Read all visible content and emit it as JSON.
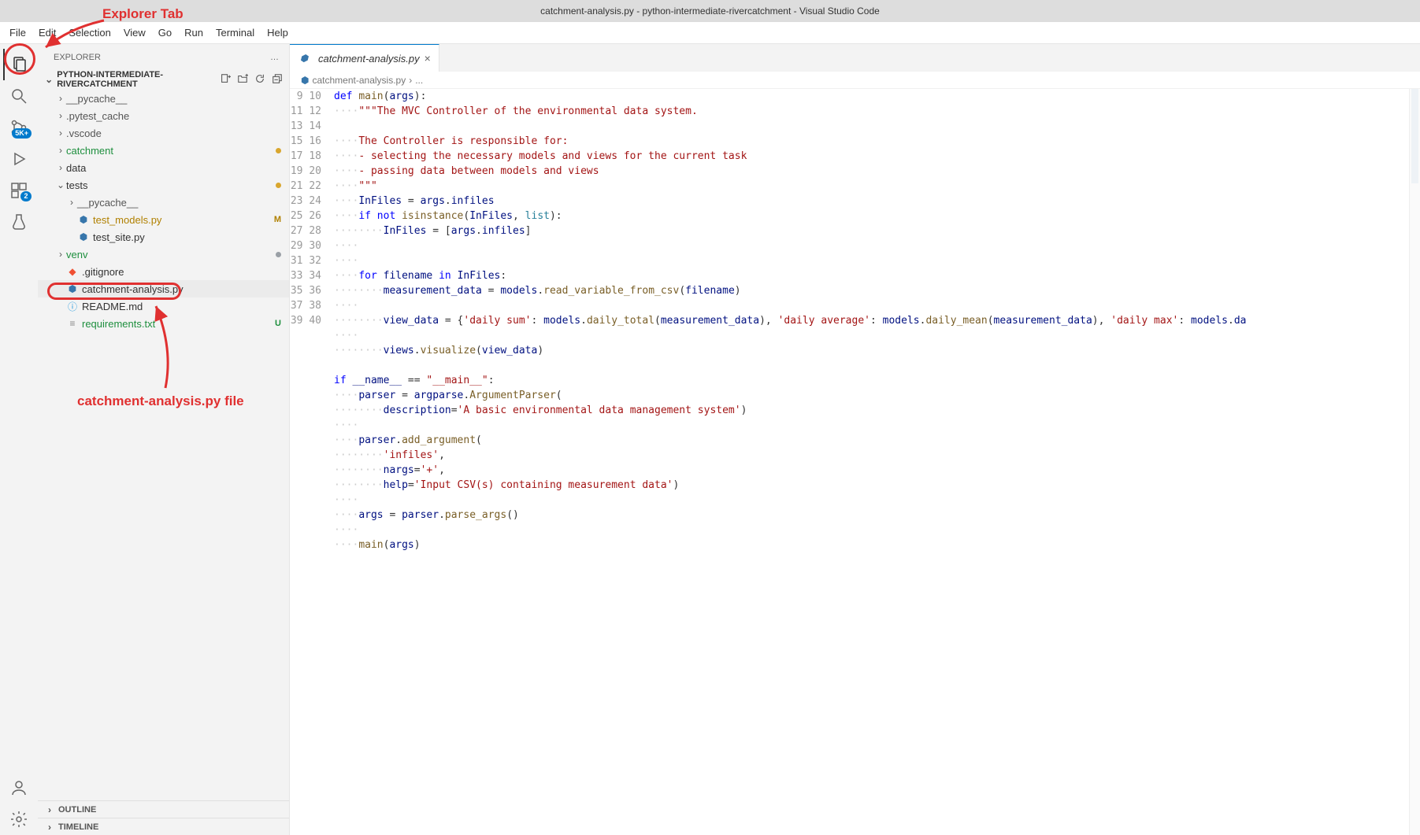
{
  "title": "catchment-analysis.py - python-intermediate-rivercatchment - Visual Studio Code",
  "menu": [
    "File",
    "Edit",
    "Selection",
    "View",
    "Go",
    "Run",
    "Terminal",
    "Help"
  ],
  "activitybar": {
    "items": [
      {
        "name": "explorer-icon",
        "active": true
      },
      {
        "name": "search-icon"
      },
      {
        "name": "source-control-icon",
        "badge": "5K+"
      },
      {
        "name": "run-debug-icon"
      },
      {
        "name": "extensions-icon",
        "badge": "2"
      },
      {
        "name": "testing-icon"
      }
    ],
    "bottom": [
      {
        "name": "accounts-icon"
      },
      {
        "name": "settings-gear-icon"
      }
    ]
  },
  "sidebar": {
    "title": "EXPLORER",
    "more": "…",
    "folder": "PYTHON-INTERMEDIATE-RIVERCATCHMENT",
    "actions": [
      "new-file-icon",
      "new-folder-icon",
      "refresh-icon",
      "collapse-all-icon"
    ],
    "tree": [
      {
        "indent": 1,
        "type": "folder",
        "chev": ">",
        "label": "__pycache__",
        "color": "#555"
      },
      {
        "indent": 1,
        "type": "folder",
        "chev": ">",
        "label": ".pytest_cache",
        "color": "#555"
      },
      {
        "indent": 1,
        "type": "folder",
        "chev": ">",
        "label": ".vscode",
        "color": "#555"
      },
      {
        "indent": 1,
        "type": "folder",
        "chev": ">",
        "label": "catchment",
        "color": "#1e8f3e",
        "dot": "#d9a62e"
      },
      {
        "indent": 1,
        "type": "folder",
        "chev": ">",
        "label": "data",
        "color": "#333"
      },
      {
        "indent": 1,
        "type": "folder",
        "chev": "⌄",
        "label": "tests",
        "color": "#333",
        "dot": "#d9a62e"
      },
      {
        "indent": 2,
        "type": "folder",
        "chev": ">",
        "label": "__pycache__",
        "color": "#555"
      },
      {
        "indent": 2,
        "type": "file",
        "icon": "py",
        "label": "test_models.py",
        "color": "#b08000",
        "status": "M",
        "statusColor": "#b08000"
      },
      {
        "indent": 2,
        "type": "file",
        "icon": "py",
        "label": "test_site.py",
        "color": "#333"
      },
      {
        "indent": 1,
        "type": "folder",
        "chev": ">",
        "label": "venv",
        "color": "#1e8f3e",
        "dot": "#9aa0a6"
      },
      {
        "indent": 1,
        "type": "file",
        "icon": "git",
        "label": ".gitignore",
        "color": "#333"
      },
      {
        "indent": 1,
        "type": "file",
        "icon": "py",
        "label": "catchment-analysis.py",
        "color": "#333",
        "highlighted": true
      },
      {
        "indent": 1,
        "type": "file",
        "icon": "info",
        "label": "README.md",
        "color": "#333"
      },
      {
        "indent": 1,
        "type": "file",
        "icon": "txt",
        "label": "requirements.txt",
        "color": "#1e8f3e",
        "status": "U",
        "statusColor": "#1e8f3e"
      }
    ],
    "panels": [
      "OUTLINE",
      "TIMELINE"
    ]
  },
  "editor": {
    "tab": {
      "icon": "py",
      "label": "catchment-analysis.py"
    },
    "breadcrumb": [
      "catchment-analysis.py",
      "..."
    ],
    "firstLine": 9,
    "lines": [
      [
        [
          "kw",
          "def "
        ],
        [
          "fn",
          "main"
        ],
        [
          "op",
          "("
        ],
        [
          "var",
          "args"
        ],
        [
          "op",
          "):"
        ]
      ],
      [
        [
          "ws",
          "····"
        ],
        [
          "docstr",
          "\"\"\"The MVC Controller of the environmental data system."
        ]
      ],
      [
        []
      ],
      [
        [
          "ws",
          "····"
        ],
        [
          "docstr",
          "The Controller is responsible for:"
        ]
      ],
      [
        [
          "ws",
          "····"
        ],
        [
          "docstr",
          "- selecting the necessary models and views for the current task"
        ]
      ],
      [
        [
          "ws",
          "····"
        ],
        [
          "docstr",
          "- passing data between models and views"
        ]
      ],
      [
        [
          "ws",
          "····"
        ],
        [
          "docstr",
          "\"\"\""
        ]
      ],
      [
        [
          "ws",
          "····"
        ],
        [
          "var",
          "InFiles"
        ],
        [
          "op",
          " = "
        ],
        [
          "var",
          "args"
        ],
        [
          "op",
          "."
        ],
        [
          "var",
          "infiles"
        ]
      ],
      [
        [
          "ws",
          "····"
        ],
        [
          "kw",
          "if"
        ],
        [
          "op",
          " "
        ],
        [
          "kw",
          "not"
        ],
        [
          "op",
          " "
        ],
        [
          "fn",
          "isinstance"
        ],
        [
          "op",
          "("
        ],
        [
          "var",
          "InFiles"
        ],
        [
          "op",
          ", "
        ],
        [
          "type",
          "list"
        ],
        [
          "op",
          "):"
        ]
      ],
      [
        [
          "ws",
          "········"
        ],
        [
          "var",
          "InFiles"
        ],
        [
          "op",
          " = ["
        ],
        [
          "var",
          "args"
        ],
        [
          "op",
          "."
        ],
        [
          "var",
          "infiles"
        ],
        [
          "op",
          "]"
        ]
      ],
      [
        [
          "ws",
          "····"
        ]
      ],
      [
        [
          "ws",
          "····"
        ]
      ],
      [
        [
          "ws",
          "····"
        ],
        [
          "kw",
          "for"
        ],
        [
          "op",
          " "
        ],
        [
          "var",
          "filename"
        ],
        [
          "op",
          " "
        ],
        [
          "kw",
          "in"
        ],
        [
          "op",
          " "
        ],
        [
          "var",
          "InFiles"
        ],
        [
          "op",
          ":"
        ]
      ],
      [
        [
          "ws",
          "········"
        ],
        [
          "var",
          "measurement_data"
        ],
        [
          "op",
          " = "
        ],
        [
          "var",
          "models"
        ],
        [
          "op",
          "."
        ],
        [
          "fn",
          "read_variable_from_csv"
        ],
        [
          "op",
          "("
        ],
        [
          "var",
          "filename"
        ],
        [
          "op",
          ")"
        ]
      ],
      [
        [
          "ws",
          "····"
        ]
      ],
      [
        [
          "ws",
          "········"
        ],
        [
          "var",
          "view_data"
        ],
        [
          "op",
          " = {"
        ],
        [
          "str",
          "'daily sum'"
        ],
        [
          "op",
          ": "
        ],
        [
          "var",
          "models"
        ],
        [
          "op",
          "."
        ],
        [
          "fn",
          "daily_total"
        ],
        [
          "op",
          "("
        ],
        [
          "var",
          "measurement_data"
        ],
        [
          "op",
          "), "
        ],
        [
          "str",
          "'daily average'"
        ],
        [
          "op",
          ": "
        ],
        [
          "var",
          "models"
        ],
        [
          "op",
          "."
        ],
        [
          "fn",
          "daily_mean"
        ],
        [
          "op",
          "("
        ],
        [
          "var",
          "measurement_data"
        ],
        [
          "op",
          "), "
        ],
        [
          "str",
          "'daily max'"
        ],
        [
          "op",
          ": "
        ],
        [
          "var",
          "models"
        ],
        [
          "op",
          "."
        ],
        [
          "var",
          "da"
        ]
      ],
      [
        [
          "ws",
          "····"
        ]
      ],
      [
        [
          "ws",
          "········"
        ],
        [
          "var",
          "views"
        ],
        [
          "op",
          "."
        ],
        [
          "fn",
          "visualize"
        ],
        [
          "op",
          "("
        ],
        [
          "var",
          "view_data"
        ],
        [
          "op",
          ")"
        ]
      ],
      [
        []
      ],
      [
        [
          "kw",
          "if"
        ],
        [
          "op",
          " "
        ],
        [
          "var",
          "__name__"
        ],
        [
          "op",
          " == "
        ],
        [
          "str",
          "\"__main__\""
        ],
        [
          "op",
          ":"
        ]
      ],
      [
        [
          "ws",
          "····"
        ],
        [
          "var",
          "parser"
        ],
        [
          "op",
          " = "
        ],
        [
          "var",
          "argparse"
        ],
        [
          "op",
          "."
        ],
        [
          "fn",
          "ArgumentParser"
        ],
        [
          "op",
          "("
        ]
      ],
      [
        [
          "ws",
          "········"
        ],
        [
          "var",
          "description"
        ],
        [
          "op",
          "="
        ],
        [
          "str",
          "'A basic environmental data management system'"
        ],
        [
          "op",
          ")"
        ]
      ],
      [
        [
          "ws",
          "····"
        ]
      ],
      [
        [
          "ws",
          "····"
        ],
        [
          "var",
          "parser"
        ],
        [
          "op",
          "."
        ],
        [
          "fn",
          "add_argument"
        ],
        [
          "op",
          "("
        ]
      ],
      [
        [
          "ws",
          "········"
        ],
        [
          "str",
          "'infiles'"
        ],
        [
          "op",
          ","
        ]
      ],
      [
        [
          "ws",
          "········"
        ],
        [
          "var",
          "nargs"
        ],
        [
          "op",
          "="
        ],
        [
          "str",
          "'+'"
        ],
        [
          "op",
          ","
        ]
      ],
      [
        [
          "ws",
          "········"
        ],
        [
          "var",
          "help"
        ],
        [
          "op",
          "="
        ],
        [
          "str",
          "'Input CSV(s) containing measurement data'"
        ],
        [
          "op",
          ")"
        ]
      ],
      [
        [
          "ws",
          "····"
        ]
      ],
      [
        [
          "ws",
          "····"
        ],
        [
          "var",
          "args"
        ],
        [
          "op",
          " = "
        ],
        [
          "var",
          "parser"
        ],
        [
          "op",
          "."
        ],
        [
          "fn",
          "parse_args"
        ],
        [
          "op",
          "()"
        ]
      ],
      [
        [
          "ws",
          "····"
        ]
      ],
      [
        [
          "ws",
          "····"
        ],
        [
          "fn",
          "main"
        ],
        [
          "op",
          "("
        ],
        [
          "var",
          "args"
        ],
        [
          "op",
          ")"
        ]
      ],
      [
        []
      ]
    ]
  },
  "annotations": {
    "explorerTab": "Explorer Tab",
    "fileLabel": "catchment-analysis.py file"
  }
}
